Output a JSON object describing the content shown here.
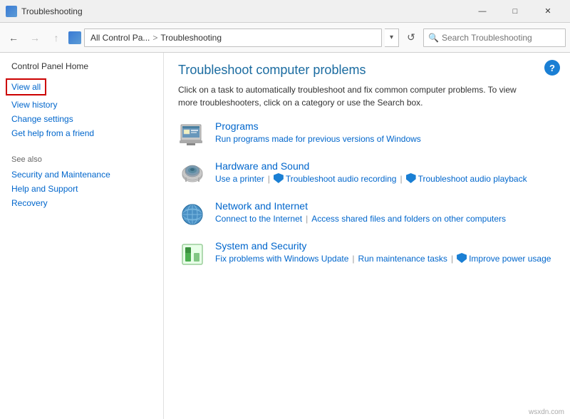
{
  "window": {
    "title": "Troubleshooting",
    "icon": "control-panel-icon"
  },
  "titlebar": {
    "minimize": "—",
    "maximize": "□",
    "close": "✕"
  },
  "addressbar": {
    "back": "←",
    "forward": "→",
    "up": "↑",
    "path_part": "All Control Pa...",
    "separator": ">",
    "current": "Troubleshooting",
    "refresh": "↺",
    "search_placeholder": "Search Troubleshooting"
  },
  "sidebar": {
    "home_label": "Control Panel Home",
    "links": [
      {
        "id": "view-all",
        "label": "View all",
        "highlighted": true
      },
      {
        "id": "view-history",
        "label": "View history",
        "highlighted": false
      },
      {
        "id": "change-settings",
        "label": "Change settings",
        "highlighted": false
      },
      {
        "id": "get-help",
        "label": "Get help from a friend",
        "highlighted": false
      }
    ],
    "see_also": {
      "heading": "See also",
      "links": [
        {
          "id": "security",
          "label": "Security and Maintenance"
        },
        {
          "id": "help",
          "label": "Help and Support"
        },
        {
          "id": "recovery",
          "label": "Recovery"
        }
      ]
    }
  },
  "content": {
    "title": "Troubleshoot computer problems",
    "description": "Click on a task to automatically troubleshoot and fix common computer problems. To view more troubleshooters, click on a category or use the Search box.",
    "categories": [
      {
        "id": "programs",
        "title": "Programs",
        "links": [
          {
            "id": "programs-link1",
            "label": "Run programs made for previous versions of Windows",
            "shield": false
          }
        ]
      },
      {
        "id": "hardware-sound",
        "title": "Hardware and Sound",
        "links": [
          {
            "id": "hw-link1",
            "label": "Use a printer",
            "shield": false
          },
          {
            "id": "hw-link2",
            "label": "Troubleshoot audio recording",
            "shield": true
          },
          {
            "id": "hw-link3",
            "label": "Troubleshoot audio playback",
            "shield": true
          }
        ]
      },
      {
        "id": "network-internet",
        "title": "Network and Internet",
        "links": [
          {
            "id": "net-link1",
            "label": "Connect to the Internet",
            "shield": false
          },
          {
            "id": "net-link2",
            "label": "Access shared files and folders on other computers",
            "shield": false
          }
        ]
      },
      {
        "id": "system-security",
        "title": "System and Security",
        "links": [
          {
            "id": "sys-link1",
            "label": "Fix problems with Windows Update",
            "shield": false
          },
          {
            "id": "sys-link2",
            "label": "Run maintenance tasks",
            "shield": false
          },
          {
            "id": "sys-link3",
            "label": "Improve power usage",
            "shield": true
          }
        ]
      }
    ]
  },
  "watermark": "wsxdn.com"
}
